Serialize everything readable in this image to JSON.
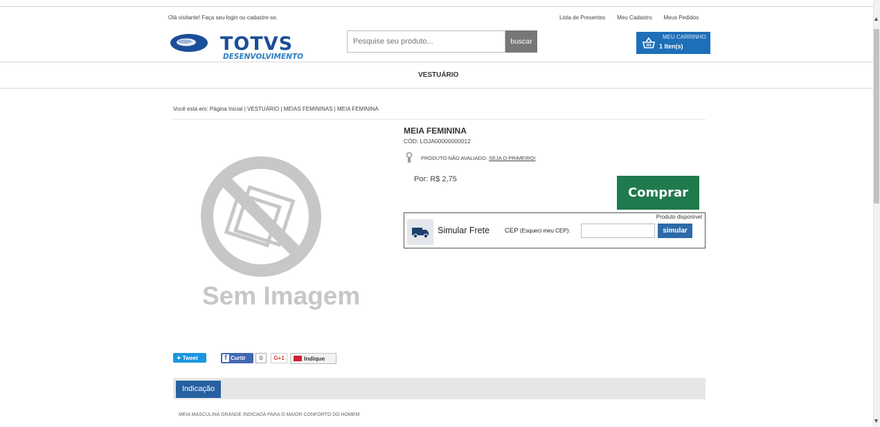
{
  "header": {
    "welcome": "Olá visitante! Faça seu login ou cadastre-se.",
    "links": [
      "Lista de Presentes",
      "Meu Cadastro",
      "Meus Pedidos"
    ],
    "logo_text": "TOTVS",
    "logo_sub": "DESENVOLVIMENTO"
  },
  "search": {
    "placeholder": "Pesquise seu produto...",
    "button": "buscar"
  },
  "cart": {
    "title": "MEU CARRINHO",
    "count": "1 Iten(s)"
  },
  "nav": {
    "item": "VESTUÁRIO"
  },
  "breadcrumb": "Você está em:   Página Inicial  | VESTUÁRIO  | MEIAS FEMININAS  |  MEIA FEMININA",
  "product": {
    "image_placeholder": "Sem Imagem",
    "name": "MEIA FEMININA",
    "code": "CÓD: LOJA00000000012",
    "rating_text": "PRODUTO NÃO AVALIADO.",
    "rating_link": "SEJA O PRIMEIRO!",
    "price": "Por: R$ 2,75",
    "buy": "Comprar"
  },
  "frete": {
    "available": "Produto disponível",
    "title": "Simular Frete",
    "cep_label": "CEP",
    "cep_forgot": "(Esqueci meu CEP):",
    "button": "simular"
  },
  "social": {
    "tweet": "Tweet",
    "fb_like": "Curtir",
    "fb_count": "0",
    "gplus": "G+1",
    "indique": "Indique"
  },
  "tabs": {
    "active": "Indicação",
    "content": "MEIA MASCULINA GRANDE INDICADA PARA O MAIOR CONFORTO DO HOMEM"
  },
  "colors": {
    "primary_blue": "#1d6fb8",
    "buy_green": "#1f7a4d",
    "tab_blue": "#2760a1"
  }
}
